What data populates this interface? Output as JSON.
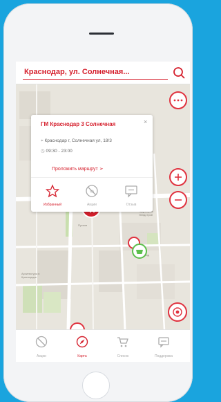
{
  "search": {
    "value": "Краснодар, ул. Солнечная..."
  },
  "popup": {
    "title": "ГМ Краснодар 3 Солнечная",
    "address": "Краснодар г, Солнечная ул, 18/3",
    "hours": "09:30 - 23:00",
    "route_label": "Проложить маршрут",
    "actions": [
      {
        "label": "Избранный",
        "icon": "star-icon"
      },
      {
        "label": "Акции",
        "icon": "no-discount-icon"
      },
      {
        "label": "Отзыв",
        "icon": "chat-icon"
      }
    ]
  },
  "map_labels": [
    "Солнечная ул.",
    "Ростов",
    "Гидропром Лендстрой",
    "Медгород",
    "Архитектура в Краснодаре",
    "Лэнд",
    "Пусков"
  ],
  "tabs": [
    {
      "label": "Акции",
      "icon": "discount-icon",
      "active": false
    },
    {
      "label": "Карта",
      "icon": "compass-icon",
      "active": true
    },
    {
      "label": "Список",
      "icon": "cart-icon",
      "active": false
    },
    {
      "label": "Поддержка",
      "icon": "message-icon",
      "active": false
    }
  ],
  "colors": {
    "accent": "#d51f2c",
    "brand_bg": "#1aa4de",
    "marker_green": "#5cbf4c"
  }
}
